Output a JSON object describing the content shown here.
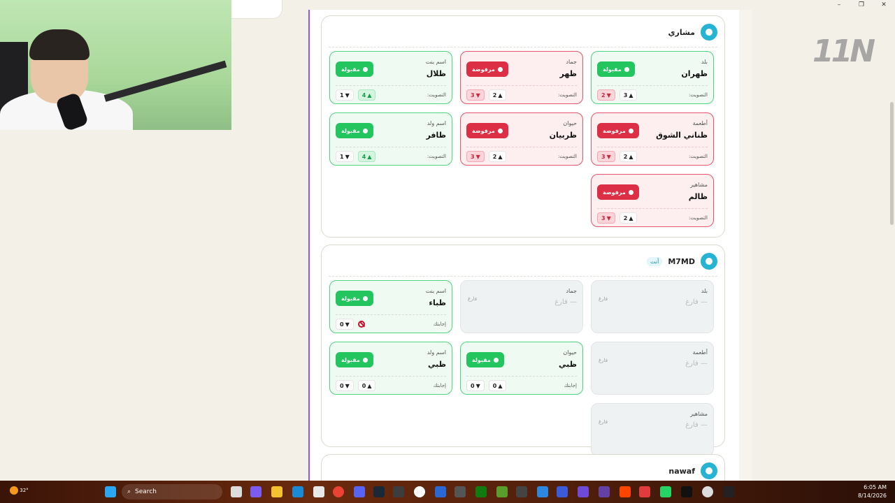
{
  "window_controls": {
    "min": "–",
    "max": "❐",
    "close": "✕"
  },
  "logo_text": "11N",
  "sections": [
    {
      "player": "مشاري",
      "is_you": false,
      "cards": [
        {
          "category": "بلد",
          "word": "ظهران",
          "status": "مقبولة",
          "state": "ok",
          "vote_label": "التصويت:",
          "up": "3",
          "down": "2",
          "hi": "down"
        },
        {
          "category": "جماد",
          "word": "ظهر",
          "status": "مرفوضة",
          "state": "no",
          "vote_label": "التصويت:",
          "up": "2",
          "down": "3",
          "hi": "down"
        },
        {
          "category": "اسم بنت",
          "word": "ظلال",
          "status": "مقبولة",
          "state": "ok",
          "vote_label": "التصويت:",
          "up": "4",
          "down": "1",
          "hi": "up"
        },
        {
          "category": "أطعمة",
          "word": "ظناني الشوق",
          "status": "مرفوضة",
          "state": "no",
          "vote_label": "التصويت:",
          "up": "2",
          "down": "3",
          "hi": "down"
        },
        {
          "category": "حيوان",
          "word": "ظربيان",
          "status": "مرفوضة",
          "state": "no",
          "vote_label": "التصويت:",
          "up": "2",
          "down": "3",
          "hi": "down"
        },
        {
          "category": "اسم ولد",
          "word": "ظافر",
          "status": "مقبولة",
          "state": "ok",
          "vote_label": "التصويت:",
          "up": "4",
          "down": "1",
          "hi": "up"
        },
        {
          "category": "مشاهير",
          "word": "ظالم",
          "status": "مرفوضة",
          "state": "no",
          "vote_label": "التصويت:",
          "up": "2",
          "down": "3",
          "hi": "down"
        }
      ]
    },
    {
      "player": "M7MD",
      "you_label": "أنت",
      "cards": [
        {
          "category": "بلد",
          "word": "— فارغ",
          "status": "فارغ",
          "state": "empty"
        },
        {
          "category": "جماد",
          "word": "— فارغ",
          "status": "فارغ",
          "state": "empty"
        },
        {
          "category": "اسم بنت",
          "word": "ظباء",
          "status": "مقبولة",
          "state": "ok",
          "vote_label": "إجابتك",
          "up": "",
          "down": "0",
          "ban": true
        },
        {
          "category": "أطعمة",
          "word": "— فارغ",
          "status": "فارغ",
          "state": "empty"
        },
        {
          "category": "حيوان",
          "word": "ظبي",
          "status": "مقبولة",
          "state": "ok",
          "vote_label": "إجابتك",
          "up": "0",
          "down": "0"
        },
        {
          "category": "اسم ولد",
          "word": "ظبي",
          "status": "مقبولة",
          "state": "ok",
          "vote_label": "إجابتك",
          "up": "0",
          "down": "0"
        },
        {
          "category": "مشاهير",
          "word": "— فارغ",
          "status": "فارغ",
          "state": "empty"
        }
      ]
    },
    {
      "player": "nawaf"
    }
  ],
  "taskbar": {
    "search": "Search",
    "weather": "32°",
    "time": "6:05 AM",
    "date": "8/14/2026"
  }
}
